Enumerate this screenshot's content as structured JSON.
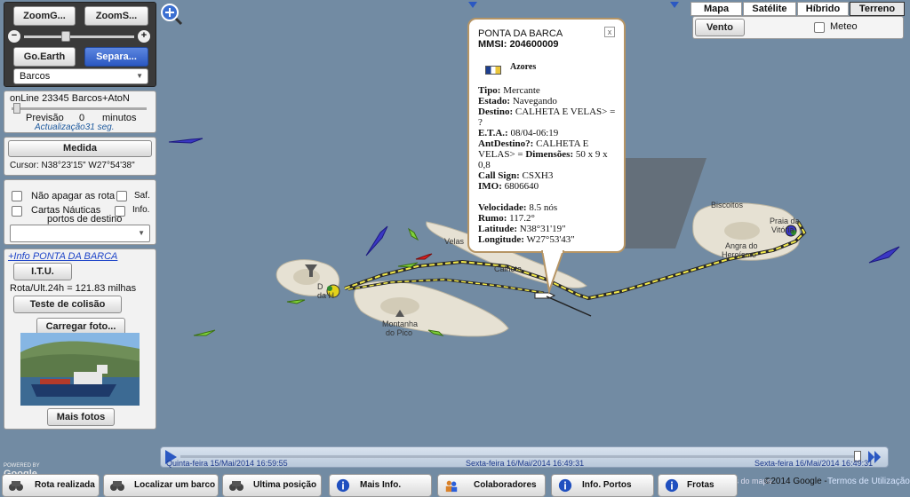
{
  "left_panel": {
    "zoom_earth_a": "ZoomG...",
    "zoom_earth_b": "ZoomS...",
    "goearth": "Go.Earth",
    "separate": "Separa...",
    "vessel_select": "Barcos",
    "online_status": "onLine 23345 Barcos+AtoN",
    "forecast_label": "Previsão",
    "forecast_value": "0",
    "forecast_unit": "minutos",
    "update_text": "Actualização31 seg.",
    "measure_button": "Medida",
    "cursor_position": "Cursor:  N38°23'15\"  W27°54'38\"",
    "opt_keep_route": "Não apagar as rota",
    "opt_saf": "Saf.",
    "opt_nautical_charts": "Cartas Náuticas",
    "opt_info": "Info.",
    "ports_label": "portos de destino",
    "info_link": "+Info PONTA DA BARCA",
    "itu_button": "I.T.U.",
    "route_info": "Rota/Ult.24h = 121.83 milhas",
    "collision_button": "Teste de colisão",
    "load_photo_button": "Carregar foto...",
    "more_photos_button": "Mais fotos"
  },
  "map_type": {
    "mapa": "Mapa",
    "satelite": "Satélite",
    "hibrido": "Híbrido",
    "terreno": "Terreno",
    "wind": "Vento",
    "weather": "Meteo",
    "selected": "Terreno"
  },
  "popup": {
    "name": "PONTA DA BARCA",
    "mmsi": "MMSI: 204600009",
    "flag_label": "Azores",
    "tipo_label": "Tipo:",
    "tipo_value": "Mercante",
    "estado_label": "Estado:",
    "estado_value": "Navegando",
    "destino_label": "Destino:",
    "destino_value": "CALHETA E VELAS> =",
    "destino_value2": "?",
    "eta_label": "E.T.A.:",
    "eta_value": "08/04-06:19",
    "antdestino_label": "AntDestino?:",
    "antdestino_value": "CALHETA E",
    "antdestino_value2": "VELAS> =",
    "dimensoes_label": "Dimensões:",
    "dimensoes_value": "50 x 9 x",
    "dimensoes_value2": "0,8",
    "callsign_label": "Call Sign:",
    "callsign_value": "CSXH3",
    "imo_label": "IMO:",
    "imo_value": "6806640",
    "velocidade_label": "Velocidade:",
    "velocidade_value": "8.5 nós",
    "rumo_label": "Rumo:",
    "rumo_value": "117.2°",
    "latitude_label": "Latitude:",
    "latitude_value": "N38°31'19\"",
    "longitude_label": "Longitude:",
    "longitude_value": "W27°53'43\"",
    "close_icon": "x"
  },
  "map_labels": {
    "biscoitos": "Biscoitos",
    "praia_a": "Praia da",
    "praia_b": "Vitória",
    "angra_a": "Angra do",
    "angra_b": "Heroísmo",
    "velas": "Velas",
    "calheta": "Calheta",
    "horta_a": "D",
    "horta_b": "da H",
    "montanha_a": "Montanha",
    "montanha_b": "do Pico"
  },
  "timeline": {
    "start": "Quinta-feira 15/Mai/2014  16:59:55",
    "middle": "Sexta-feira 16/Mai/2014  16:49:31",
    "end": "Sexta-feira 16/Mai/2014  16:49:31"
  },
  "footer": {
    "powered_by": "POWERED BY",
    "google_logo": "Google",
    "map_data": "Dados do mapa",
    "copyright": "©2014 Google -",
    "terms": "Termos de Utilização",
    "rota_realizada": "Rota realizada",
    "localizar_barco": "Localizar um barco",
    "ultima_posicao": "Ultima posição",
    "mais_info": "Mais Info.",
    "colaboradores": "Colaboradores",
    "info_portos": "Info. Portos",
    "frotas": "Frotas"
  },
  "colors": {
    "sea": "#728ba3",
    "track": "#f2e94a",
    "popup_border": "#b69565",
    "button_blue": "#2b58c2"
  }
}
